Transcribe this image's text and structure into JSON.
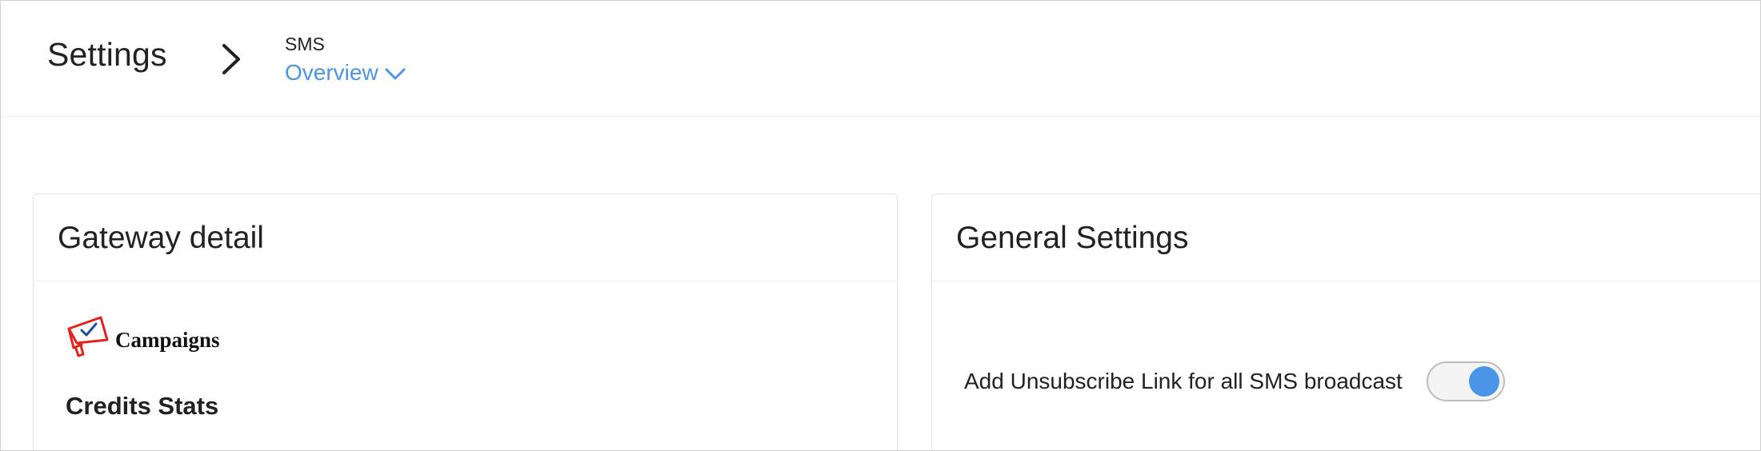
{
  "header": {
    "title": "Settings",
    "breadcrumb_parent": "SMS",
    "breadcrumb_current": "Overview"
  },
  "gateway_card": {
    "title": "Gateway detail",
    "brand_name": "Campaigns",
    "section_title": "Credits Stats"
  },
  "general_card": {
    "title": "General Settings",
    "unsubscribe_label": "Add Unsubscribe Link for all SMS broadcast",
    "unsubscribe_enabled": true
  },
  "colors": {
    "accent": "#4a95e5",
    "brand_red": "#e2231a",
    "brand_blue": "#1f4e9c"
  },
  "icons": {
    "breadcrumb_separator": "chevron-right-icon",
    "dropdown": "chevron-down-icon",
    "brand_logo": "megaphone-icon"
  }
}
